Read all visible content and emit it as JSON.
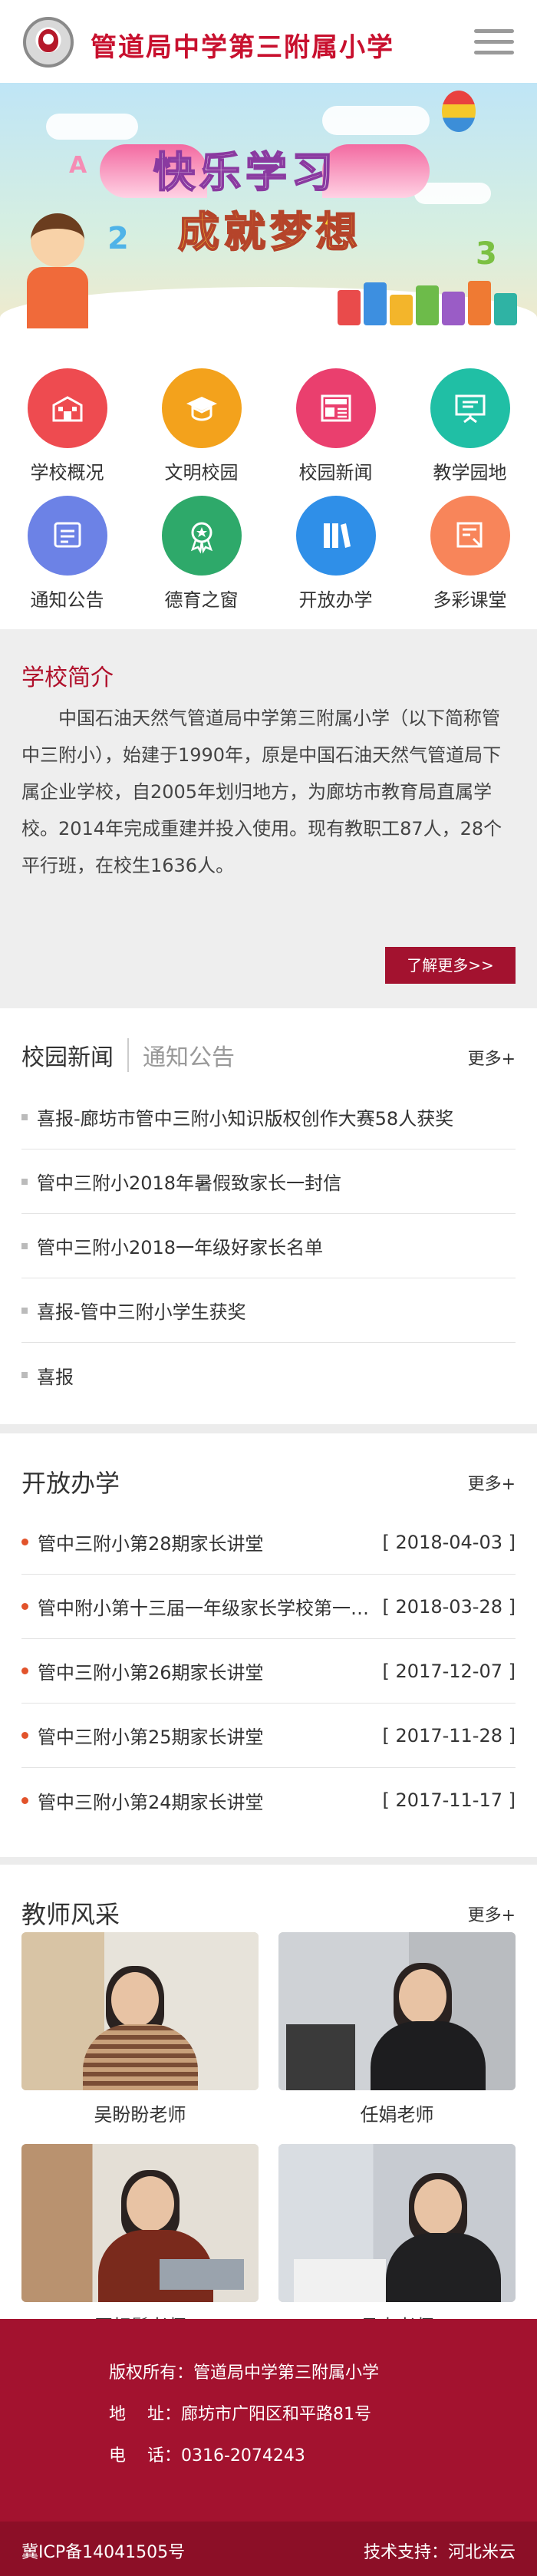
{
  "header": {
    "school_name": "管道局中学第三附属小学"
  },
  "nav": [
    {
      "label": "学校概况",
      "icon": "school-building-icon",
      "color": "#ee4b50"
    },
    {
      "label": "文明校园",
      "icon": "graduation-cap-icon",
      "color": "#f3a21c"
    },
    {
      "label": "校园新闻",
      "icon": "newspaper-icon",
      "color": "#ea3f6e"
    },
    {
      "label": "教学园地",
      "icon": "presentation-board-icon",
      "color": "#20bfa5"
    },
    {
      "label": "通知公告",
      "icon": "notice-screen-icon",
      "color": "#6c82e6"
    },
    {
      "label": "德育之窗",
      "icon": "award-medal-icon",
      "color": "#2ea96a"
    },
    {
      "label": "开放办学",
      "icon": "books-icon",
      "color": "#2f8fe8"
    },
    {
      "label": "多彩课堂",
      "icon": "classroom-icon",
      "color": "#f8855a"
    }
  ],
  "intro": {
    "title": "学校简介",
    "text": "中国石油天然气管道局中学第三附属小学（以下简称管中三附小），始建于1990年，原是中国石油天然气管道局下属企业学校，自2005年划归地方，为廊坊市教育局直属学校。2014年完成重建并投入使用。现有教职工87人，28个平行班，在校生1636人。",
    "more_label": "了解更多>>"
  },
  "news": {
    "tab_active": "校园新闻",
    "tab_inactive": "通知公告",
    "more_label": "更多+",
    "items": [
      "喜报-廊坊市管中三附小知识版权创作大赛58人获奖",
      "管中三附小2018年暑假致家长一封信",
      "管中三附小2018一年级好家长名单",
      "喜报-管中三附小学生获奖",
      "喜报"
    ]
  },
  "open_school": {
    "title": "开放办学",
    "more_label": "更多+",
    "items": [
      {
        "text": "管中三附小第28期家长讲堂",
        "date": "[ 2018-04-03 ]"
      },
      {
        "text": "管中附小第十三届一年级家长学校第一期家长讲堂",
        "date": "[ 2018-03-28 ]"
      },
      {
        "text": "管中三附小第26期家长讲堂",
        "date": "[ 2017-12-07 ]"
      },
      {
        "text": "管中三附小第25期家长讲堂",
        "date": "[ 2017-11-28 ]"
      },
      {
        "text": "管中三附小第24期家长讲堂",
        "date": "[ 2017-11-17 ]"
      }
    ]
  },
  "teachers": {
    "title": "教师风采",
    "more_label": "更多+",
    "items": [
      {
        "name": "吴盼盼老师"
      },
      {
        "name": "任娟老师"
      },
      {
        "name": "历相鬘老师"
      },
      {
        "name": "吕森老师"
      }
    ]
  },
  "footer": {
    "copyright": "版权所有：管道局中学第三附属小学",
    "address": "地    址：廊坊市广阳区和平路81号",
    "phone": "电    话：0316-2074243",
    "icp": "冀ICP备14041505号",
    "tech_support": "技术支持：河北米云"
  }
}
